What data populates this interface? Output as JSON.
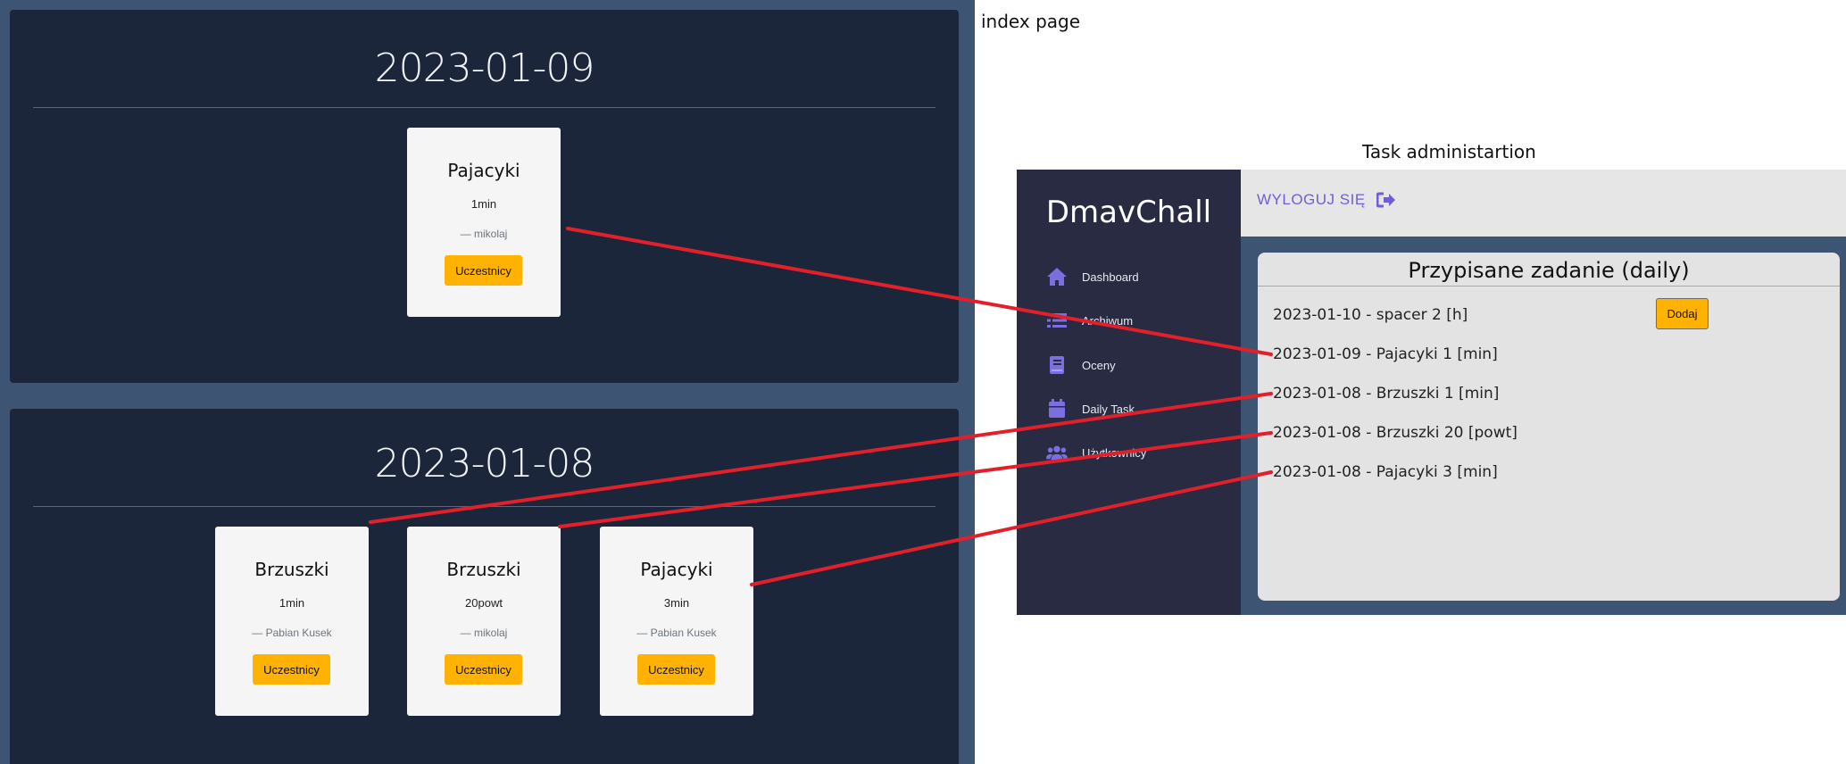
{
  "annotations": {
    "index_label": "index page",
    "admin_label": "Task administartion"
  },
  "index": {
    "days": [
      {
        "date": "2023-01-09",
        "tasks": [
          {
            "name": "Pajacyki",
            "amount": "1min",
            "author": "— mikolaj",
            "button": "Uczestnicy"
          }
        ]
      },
      {
        "date": "2023-01-08",
        "tasks": [
          {
            "name": "Brzuszki",
            "amount": "1min",
            "author": "— Pabian Kusek",
            "button": "Uczestnicy"
          },
          {
            "name": "Brzuszki",
            "amount": "20powt",
            "author": "— mikolaj",
            "button": "Uczestnicy"
          },
          {
            "name": "Pajacyki",
            "amount": "3min",
            "author": "— Pabian Kusek",
            "button": "Uczestnicy"
          }
        ]
      }
    ]
  },
  "admin": {
    "brand": "DmavChall",
    "logout_label": "WYLOGUJ SIĘ",
    "nav": [
      {
        "label": "Dashboard",
        "icon": "home-icon"
      },
      {
        "label": "Archiwum",
        "icon": "list-icon"
      },
      {
        "label": "Oceny",
        "icon": "book-icon"
      },
      {
        "label": "Daily Task",
        "icon": "calendar-icon"
      },
      {
        "label": "Użytkownicy",
        "icon": "users-icon"
      }
    ],
    "panel_title": "Przypisane zadanie (daily)",
    "add_button": "Dodaj",
    "tasks": [
      "2023-01-10 - spacer 2 [h]",
      "2023-01-09 - Pajacyki 1 [min]",
      "2023-01-08 - Brzuszki 1 [min]",
      "2023-01-08 - Brzuszki 20 [powt]",
      "2023-01-08 - Pajacyki 3 [min]"
    ]
  },
  "colors": {
    "page_bg": "#3d5573",
    "panel_bg": "#1c263b",
    "card_bg": "#f5f5f5",
    "accent_button": "#ffb300",
    "sidebar_bg": "#282b42",
    "nav_icon": "#7b6fe0",
    "logout_text": "#6e5fd6",
    "connector": "#e3202a"
  }
}
